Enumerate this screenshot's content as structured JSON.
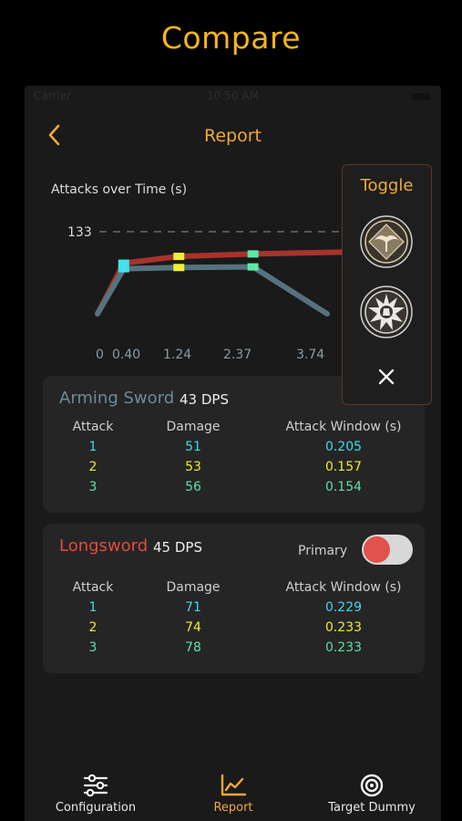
{
  "heading": "Compare",
  "status_bar": {
    "carrier": "Carrier",
    "time": "10:50 AM"
  },
  "nav": {
    "title": "Report",
    "back_icon": "chevron-left-icon"
  },
  "chart_data": {
    "type": "line",
    "title": "Attacks over Time (s)",
    "reference_line": {
      "value": 133,
      "label": "133",
      "style": "dashed"
    },
    "x_tick_labels": [
      "0",
      "0.40",
      "1.24",
      "2.37",
      "3.74"
    ],
    "series": [
      {
        "color": "#a8332b",
        "points": [
          [
            0.0,
            0
          ],
          [
            0.4,
            82
          ],
          [
            1.24,
            93
          ],
          [
            2.37,
            97
          ],
          [
            3.74,
            100
          ],
          [
            4.3,
            45
          ]
        ],
        "markers": [
          "#44e0ee",
          "#f0ee3a",
          "#5ee6a6"
        ]
      },
      {
        "color": "#56727e",
        "points": [
          [
            0.0,
            0
          ],
          [
            0.4,
            73
          ],
          [
            1.24,
            75
          ],
          [
            2.37,
            76
          ],
          [
            3.5,
            0
          ]
        ],
        "markers": [
          "#44e0ee",
          "#f0ee3a",
          "#5ee6a6"
        ]
      }
    ]
  },
  "toggle_panel": {
    "title": "Toggle",
    "icons": [
      "winged-emblem-icon",
      "burst-emblem-icon"
    ],
    "close_icon": "close-icon"
  },
  "weapons": [
    {
      "name": "Arming Sword",
      "name_color": "#6a8c98",
      "dps": "43 DPS",
      "headers": [
        "Attack",
        "Damage",
        "Attack Window (s)"
      ],
      "rows": [
        {
          "attack": "1",
          "damage": "51",
          "window": "0.205",
          "color": "#44d8e8"
        },
        {
          "attack": "2",
          "damage": "53",
          "window": "0.157",
          "color": "#eeea3c"
        },
        {
          "attack": "3",
          "damage": "56",
          "window": "0.154",
          "color": "#5ee0a8"
        }
      ]
    },
    {
      "name": "Longsword",
      "name_color": "#e24a40",
      "dps": "45 DPS",
      "primary_label": "Primary",
      "primary_on": true,
      "headers": [
        "Attack",
        "Damage",
        "Attack Window (s)"
      ],
      "rows": [
        {
          "attack": "1",
          "damage": "71",
          "window": "0.229",
          "color": "#44d8e8"
        },
        {
          "attack": "2",
          "damage": "74",
          "window": "0.233",
          "color": "#eeea3c"
        },
        {
          "attack": "3",
          "damage": "78",
          "window": "0.233",
          "color": "#5ee0a8"
        }
      ]
    }
  ],
  "tabbar": {
    "items": [
      {
        "label": "Configuration",
        "icon": "sliders-icon",
        "active": false
      },
      {
        "label": "Report",
        "icon": "line-chart-icon",
        "active": true
      },
      {
        "label": "Target Dummy",
        "icon": "target-icon",
        "active": false
      }
    ],
    "active_color": "#f0a83a"
  }
}
